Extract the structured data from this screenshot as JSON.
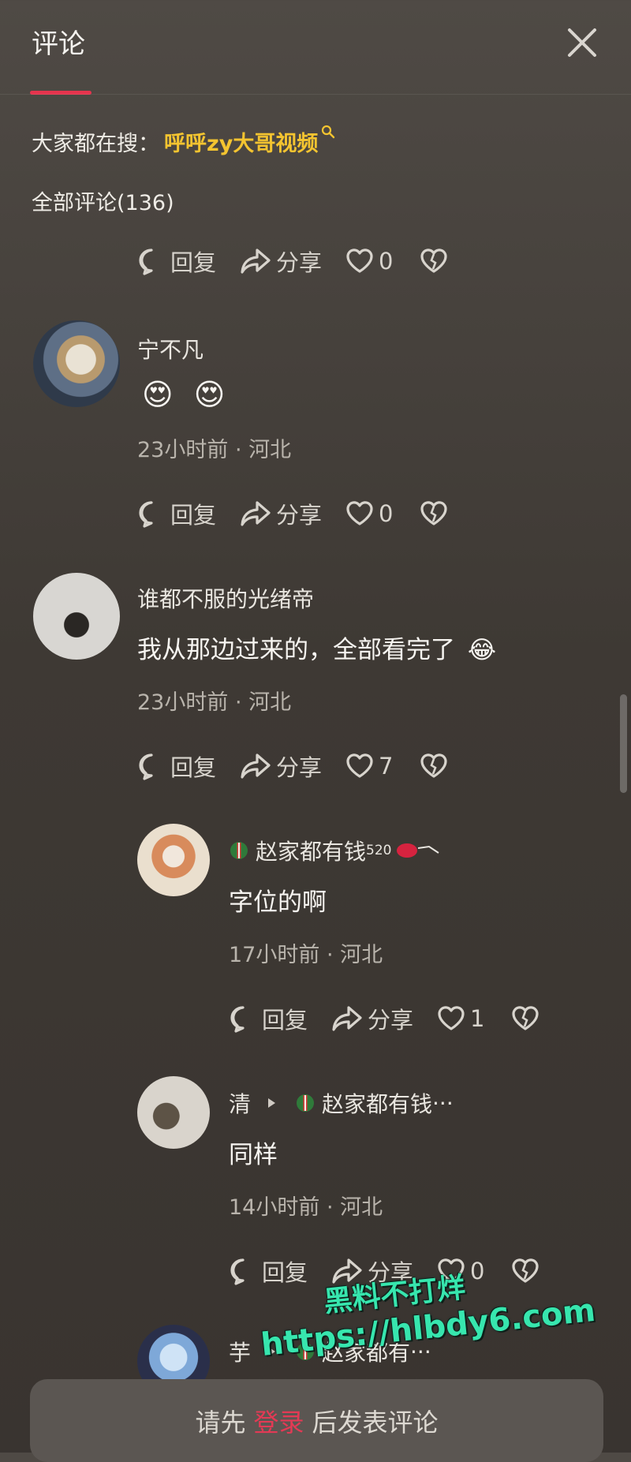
{
  "header": {
    "title": "评论"
  },
  "search_suggestion": {
    "prefix": "大家都在搜：",
    "keyword": "呼呼zy大哥视频"
  },
  "total_comments_label": "全部评论(136)",
  "top_actions": {
    "reply": "回复",
    "share": "分享",
    "likes": "0"
  },
  "comments": [
    {
      "username": "宁不凡",
      "text_emojis": [
        "😍",
        "😍"
      ],
      "meta": "23小时前 · 河北",
      "reply": "回复",
      "share": "分享",
      "likes": "0"
    },
    {
      "username": "谁都不服的光绪帝",
      "text": "我从那边过来的，全部看完了",
      "emoji": "😂",
      "meta": "23小时前 · 河北",
      "reply": "回复",
      "share": "分享",
      "likes": "7"
    }
  ],
  "replies": [
    {
      "username": "赵家都有钱",
      "username_suffix": "520",
      "text": "字位的啊",
      "meta": "17小时前 · 河北",
      "reply": "回复",
      "share": "分享",
      "likes": "1"
    },
    {
      "username": "清",
      "reply_to": "赵家都有钱",
      "ellipsis": "···",
      "text": "同样",
      "meta": "14小时前 · 河北",
      "reply": "回复",
      "share": "分享",
      "likes": "0"
    },
    {
      "username": "芋",
      "reply_to": "赵家都有",
      "ellipsis": "···"
    }
  ],
  "watermark": {
    "line1": "黑料不打烊",
    "line2": "https://hlbdy6.com"
  },
  "bottom_bar": {
    "before": "请先",
    "login": "登录",
    "after": "后发表评论"
  },
  "colors": {
    "accent": "#e5344d",
    "keyword": "#f4c430",
    "watermark": "#37e6ae",
    "background": "#433e39"
  },
  "icons": [
    "close-icon",
    "search-icon",
    "reply-bubble-icon",
    "share-arrow-icon",
    "heart-icon",
    "dislike-broken-heart-icon",
    "play-triangle-icon",
    "badge-icon"
  ]
}
